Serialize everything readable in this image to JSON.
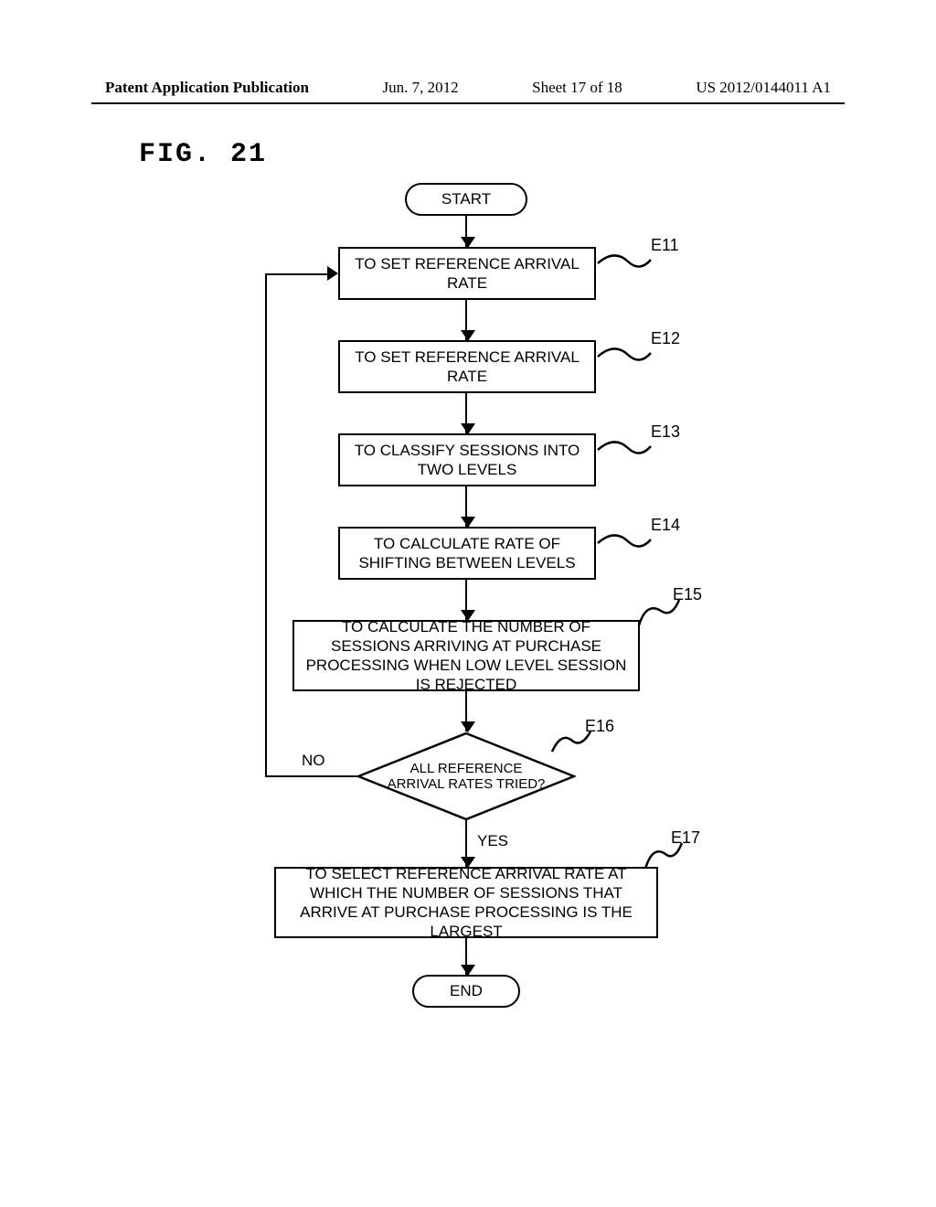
{
  "header": {
    "pub_label": "Patent Application Publication",
    "date": "Jun. 7, 2012",
    "sheet": "Sheet 17 of 18",
    "pubnum": "US 2012/0144011 A1"
  },
  "figure_title": "FIG. 21",
  "flow": {
    "start": "START",
    "end": "END",
    "steps": {
      "e11": {
        "label": "E11",
        "text": "TO SET REFERENCE ARRIVAL RATE"
      },
      "e12": {
        "label": "E12",
        "text": "TO SET REFERENCE ARRIVAL RATE"
      },
      "e13": {
        "label": "E13",
        "text": "TO CLASSIFY SESSIONS INTO TWO LEVELS"
      },
      "e14": {
        "label": "E14",
        "text": "TO CALCULATE RATE OF SHIFTING BETWEEN LEVELS"
      },
      "e15": {
        "label": "E15",
        "text": "TO CALCULATE THE NUMBER OF SESSIONS ARRIVING AT PURCHASE PROCESSING WHEN LOW LEVEL SESSION IS REJECTED"
      },
      "e16": {
        "label": "E16",
        "text": "ALL REFERENCE ARRIVAL RATES TRIED?"
      },
      "e17": {
        "label": "E17",
        "text": "TO SELECT REFERENCE ARRIVAL RATE AT WHICH THE NUMBER OF SESSIONS THAT ARRIVE AT PURCHASE PROCESSING IS THE LARGEST"
      }
    },
    "branches": {
      "yes": "YES",
      "no": "NO"
    }
  }
}
